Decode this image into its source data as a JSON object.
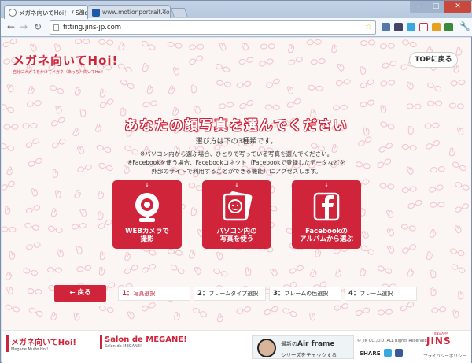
{
  "browser": {
    "tabs": [
      {
        "label": "メガネ向いてHoi！ / Salon",
        "active": true
      },
      {
        "label": "www.motionportrait.com",
        "active": false
      }
    ],
    "url": "fitting.jins-jp.com"
  },
  "page": {
    "logo_title": "メガネ向いてHoi!",
    "logo_subtitle": "自分にメガネをかけてメガネ（あっち）向いてHoi!",
    "top_button": "TOPに戻る",
    "heading": "あなたの顔写真を選んでください",
    "subheading": "選び方は下の3種類です。",
    "notes": [
      "※パソコン内から選ぶ場合、ひとりで写っている写真を選んでください。",
      "※Facebookを使う場合、Facebookコネクト（Facebookで登録したデータなどを",
      "外部のサイトで利用することができる機能）にアクセスします。"
    ],
    "options": [
      {
        "arrow": "↓",
        "line1": "WEBカメラで",
        "line2": "撮影",
        "icon": "webcam-icon"
      },
      {
        "arrow": "↓",
        "line1": "パソコン内の",
        "line2": "写真を使う",
        "icon": "photo-icon"
      },
      {
        "arrow": "↓",
        "line1": "Facebookの",
        "line2": "アルバムから選ぶ",
        "icon": "facebook-icon"
      }
    ],
    "back_button": "← 戻る",
    "steps": [
      {
        "num": "1：",
        "label": "写真選択",
        "active": true
      },
      {
        "num": "2：",
        "label": "フレームタイプ選択",
        "active": false
      },
      {
        "num": "3：",
        "label": "フレームの色選択",
        "active": false
      },
      {
        "num": "4：",
        "label": "フレーム選択",
        "active": false
      }
    ]
  },
  "footer": {
    "brand1_title": "メガネ向いてHoi!",
    "brand1_sub": "Megane Muite Hoi!",
    "brand2_title": "Salon de MEGANE!",
    "brand2_sub": "Salon de MEGANE!",
    "banner_line1_prefix": "最新の",
    "banner_line1_bold": "Air frame",
    "banner_line2": "シリーズをチェックする",
    "copyright": "© JIN CO.,LTD. ALL Rights Reserved.",
    "share": "SHARE",
    "jins_small": "JINS|APP",
    "jins_logo": "JINS",
    "privacy": "プライバシーポリシー"
  },
  "colors": {
    "accent": "#d0243a"
  }
}
